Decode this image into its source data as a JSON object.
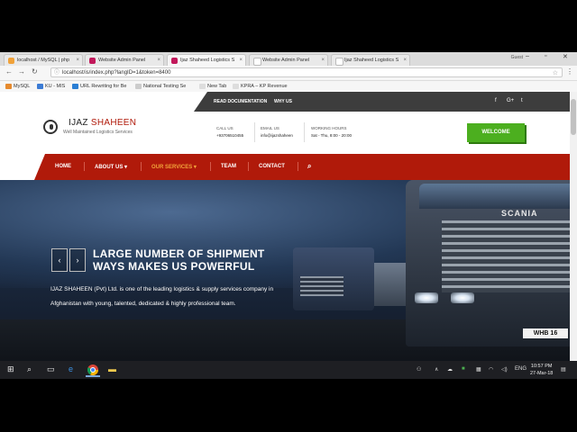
{
  "browser": {
    "tabs": [
      {
        "title": "localhost / MySQL | php",
        "favicon_color": "#f0a23a"
      },
      {
        "title": "Website Admin Panel",
        "favicon_color": "#c2185b"
      },
      {
        "title": "Ijaz Shaheed Logistics Se",
        "favicon_color": "#c2185b"
      },
      {
        "title": "Website Admin Panel",
        "favicon_color": "#ffffff"
      },
      {
        "title": "Ijaz Shaheed Logistics Se",
        "favicon_color": "#ffffff"
      }
    ],
    "profile": "Guest",
    "url": "localhost/is/index.php?langID=1&token=8400",
    "bookmarks": [
      {
        "label": "MySQL",
        "color": "#e68a2e"
      },
      {
        "label": "KU - MIS",
        "color": "#3b7bd4"
      },
      {
        "label": "URL Rewriting for Be",
        "color": "#2a7fd4"
      },
      {
        "label": "National Testing Se",
        "color": "#cccccc"
      },
      {
        "label": "New Tab",
        "color": "#dddddd"
      },
      {
        "label": "KPRA – KP Revenue",
        "color": "#dddddd"
      }
    ]
  },
  "site": {
    "toplinks": [
      "READ DOCUMENTATION",
      "WHY US"
    ],
    "social": [
      "f",
      "G+",
      "t"
    ],
    "logo": {
      "first": "IJAZ",
      "second": "SHAHEEN",
      "tagline": "Well Maintained Logistics Services"
    },
    "call": {
      "label": "CALL US",
      "value": "+93706510455"
    },
    "email": {
      "label": "EMAIL US",
      "value": "info@ijazshaheen"
    },
    "hours": {
      "label": "WORKING HOURS",
      "value": "Sat - Thu, 8:00 - 20:00"
    },
    "welcome": "WELCOME",
    "nav": [
      "HOME",
      "ABOUT US ▾",
      "OUR SERVICES ▾",
      "TEAM",
      "CONTACT"
    ],
    "search_icon": "⌕",
    "hero": {
      "title": "LARGE NUMBER OF SHIPMENT WAYS MAKES US POWERFUL",
      "desc": "IJAZ SHAHEEN (Pvt) Ltd. is one of the leading logistics & supply services company in Afghanistan with young, talented, dedicated & highly professional team.",
      "prev": "‹",
      "next": "›",
      "brand": "SCANIA",
      "plate": "WHB 16"
    }
  },
  "taskbar": {
    "time": "10:57 PM",
    "date": "27-Mar-18",
    "lang": "ENG"
  }
}
